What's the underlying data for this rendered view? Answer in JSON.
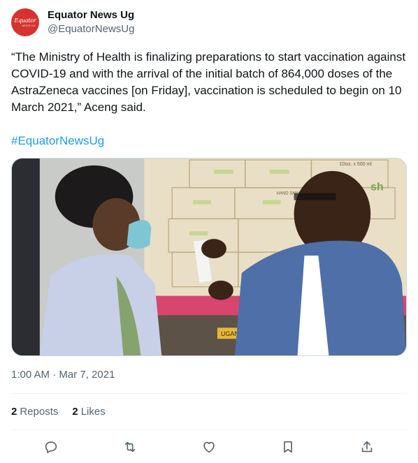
{
  "author": {
    "display_name": "Equator News Ug",
    "handle": "@EquatorNewsUg",
    "avatar_logo_text": "Equator",
    "avatar_logo_sub": "NEWS UG"
  },
  "tweet": {
    "text": "“The Ministry of Health is finalizing preparations to start vaccination against COVID-19 and with the arrival of the initial batch of 864,000 doses of the AstraZeneca vaccines [on Friday], vaccination is scheduled to begin on 10 March 2021,” Aceng said.",
    "hashtag": "#EquatorNewsUg",
    "timestamp": "1:00 AM · Mar 7, 2021"
  },
  "media": {
    "box_label_hand_sanitizer": "HAND SANITIZER",
    "box_label_doz": "1Doz. x 500 ml",
    "box_label_sh": "sh",
    "truck_label": "UGANDA"
  },
  "stats": {
    "reposts_count": "2",
    "reposts_label": "Reposts",
    "likes_count": "2",
    "likes_label": "Likes"
  },
  "actions": [
    {
      "icon": "reply-icon"
    },
    {
      "icon": "repost-icon"
    },
    {
      "icon": "like-icon"
    },
    {
      "icon": "bookmark-icon"
    },
    {
      "icon": "share-icon"
    }
  ],
  "colors": {
    "link": "#1d9bf0",
    "secondary_text": "#536471",
    "avatar_bg": "#d6322f",
    "icon": "#536471"
  }
}
